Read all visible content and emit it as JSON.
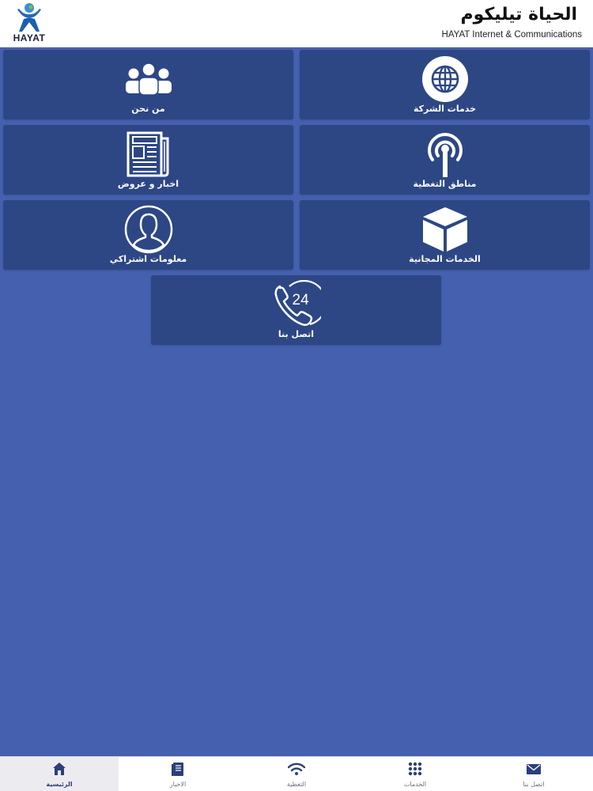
{
  "header": {
    "logo_text": "HAYAT",
    "brand_ar": "الحياة تيليكوم",
    "brand_en": "HAYAT Internet & Communications"
  },
  "tiles": [
    {
      "label": "خدمات الشركة",
      "icon": "globe-icon"
    },
    {
      "label": "من نحن",
      "icon": "people-icon"
    },
    {
      "label": "مناطق التغطية",
      "icon": "antenna-icon"
    },
    {
      "label": "اخبار و عروض",
      "icon": "newspaper-icon"
    },
    {
      "label": "الخدمات المجانية",
      "icon": "box-icon"
    },
    {
      "label": "معلومات اشتراكي",
      "icon": "user-icon"
    },
    {
      "label": "اتصل بنا",
      "icon": "phone-24-icon",
      "badge": "24"
    }
  ],
  "tabbar": {
    "items": [
      {
        "label": "الرئيسية",
        "icon": "home-icon",
        "active": true
      },
      {
        "label": "الاخبار",
        "icon": "news-icon",
        "active": false
      },
      {
        "label": "التغطية",
        "icon": "wifi-icon",
        "active": false
      },
      {
        "label": "الخدمات",
        "icon": "grid-icon",
        "active": false
      },
      {
        "label": "اتصل بنا",
        "icon": "mail-icon",
        "active": false
      }
    ]
  },
  "colors": {
    "background": "#4560ae",
    "tile": "#2d4785",
    "active_tab": "#2c3f7a"
  }
}
